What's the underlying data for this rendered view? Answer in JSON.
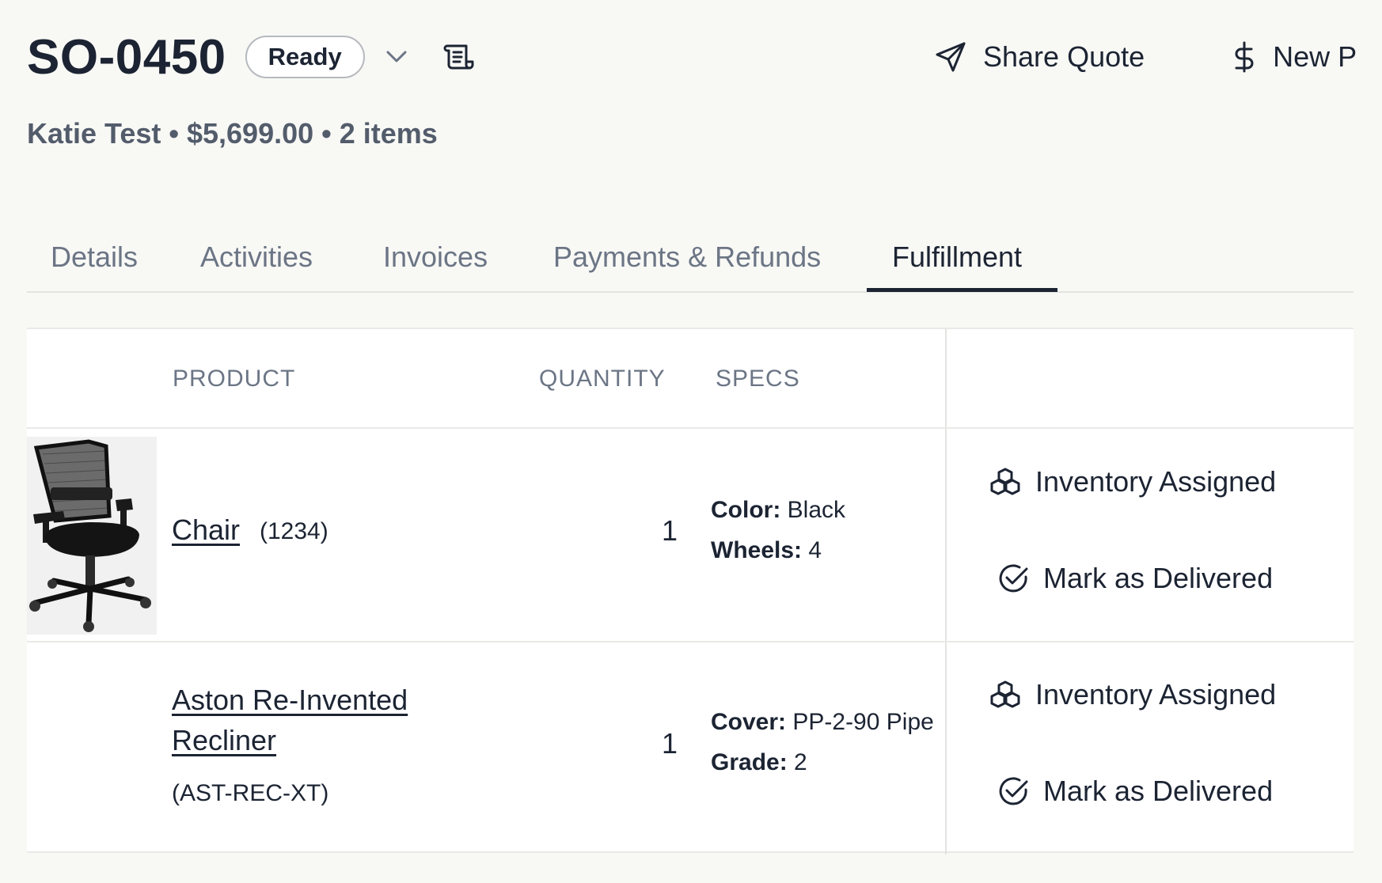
{
  "order": {
    "id": "SO-0450",
    "status": "Ready",
    "summary": "Katie Test • $5,699.00 • 2 items"
  },
  "actions": {
    "share_quote": "Share Quote",
    "new_payment": "New P"
  },
  "tabs": [
    {
      "label": "Details"
    },
    {
      "label": "Activities"
    },
    {
      "label": "Invoices"
    },
    {
      "label": "Payments & Refunds"
    },
    {
      "label": "Fulfillment",
      "active": true
    }
  ],
  "table": {
    "headers": {
      "product": "PRODUCT",
      "quantity": "QUANTITY",
      "specs": "SPECS"
    },
    "rows": [
      {
        "name": "Chair",
        "sku": "(1234)",
        "quantity": "1",
        "specs": [
          {
            "label": "Color:",
            "value": "Black"
          },
          {
            "label": "Wheels:",
            "value": "4"
          }
        ],
        "status": "Inventory Assigned",
        "action": "Mark as Delivered"
      },
      {
        "name_line1": "Aston Re-Invented",
        "name_line2": "Recliner",
        "sku": "(AST-REC-XT)",
        "quantity": "1",
        "specs": [
          {
            "label": "Cover:",
            "value": "PP-2-90 Pipe"
          },
          {
            "label": "Grade:",
            "value": "2"
          }
        ],
        "status": "Inventory Assigned",
        "action": "Mark as Delivered"
      }
    ]
  },
  "icons": {
    "chevron": "chevron-down-icon",
    "scroll": "scroll-icon",
    "send": "send-icon",
    "dollar": "dollar-icon",
    "inventory": "boxes-icon",
    "delivered": "check-circle-icon"
  }
}
